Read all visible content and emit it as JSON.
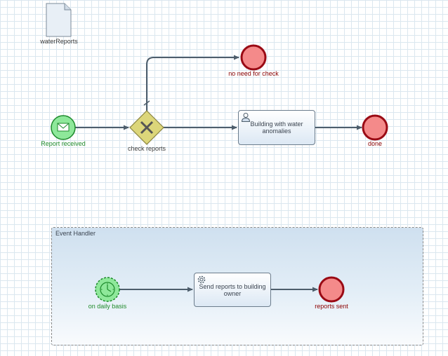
{
  "data_object": {
    "label": "waterReports"
  },
  "start_event": {
    "label": "Report received"
  },
  "gateway": {
    "label": "check reports"
  },
  "end_no_need": {
    "label": "no need for check"
  },
  "task_water": {
    "label": "Building with water anomalies"
  },
  "end_done": {
    "label": "done"
  },
  "event_subprocess": {
    "title": "Event Handler",
    "timer_start": {
      "label": "on daily basis"
    },
    "task_send": {
      "label": "Send reports to building owner"
    },
    "end_sent": {
      "label": "reports sent"
    }
  },
  "colors": {
    "start_fill": "#8ee89a",
    "start_stroke": "#1d8a2c",
    "end_fill": "#f48a8a",
    "end_stroke": "#9a0a14",
    "gateway_fill": "#dcd67a",
    "edge": "#4e5e6c"
  },
  "icons": {
    "data_object": "document-icon",
    "start_event": "envelope-icon",
    "gateway": "x-gateway-icon",
    "task_water": "user-icon",
    "timer_start": "clock-icon",
    "task_send": "gear-icon"
  }
}
